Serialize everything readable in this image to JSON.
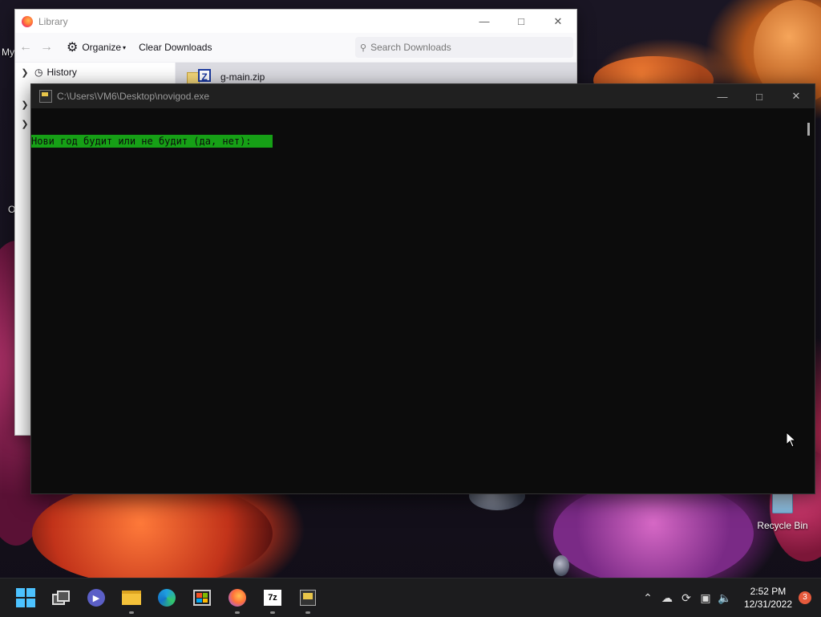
{
  "desktop": {
    "partial_label_1": "My",
    "partial_label_2": "O",
    "recycle_bin_label": "Recycle Bin"
  },
  "library_window": {
    "title": "Library",
    "toolbar": {
      "organize_label": "Organize",
      "clear_downloads_label": "Clear Downloads",
      "search_placeholder": "Search Downloads"
    },
    "sidebar": {
      "items": [
        {
          "label": "History",
          "icon": "clock-icon"
        }
      ]
    },
    "downloads": [
      {
        "name": "g-main.zip",
        "icon": "zip-file-icon"
      }
    ]
  },
  "console_window": {
    "title": "C:\\Users\\VM6\\Desktop\\novigod.exe",
    "output_line": "Нови год будит или не будит (да, нет):",
    "highlight_color": "#16a016"
  },
  "taskbar": {
    "apps": [
      "start",
      "task-view",
      "teams-meet",
      "file-explorer",
      "edge",
      "microsoft-store",
      "firefox",
      "7-zip",
      "console"
    ],
    "clock": {
      "time": "2:52 PM",
      "date": "12/31/2022"
    },
    "notification_count": "3"
  }
}
